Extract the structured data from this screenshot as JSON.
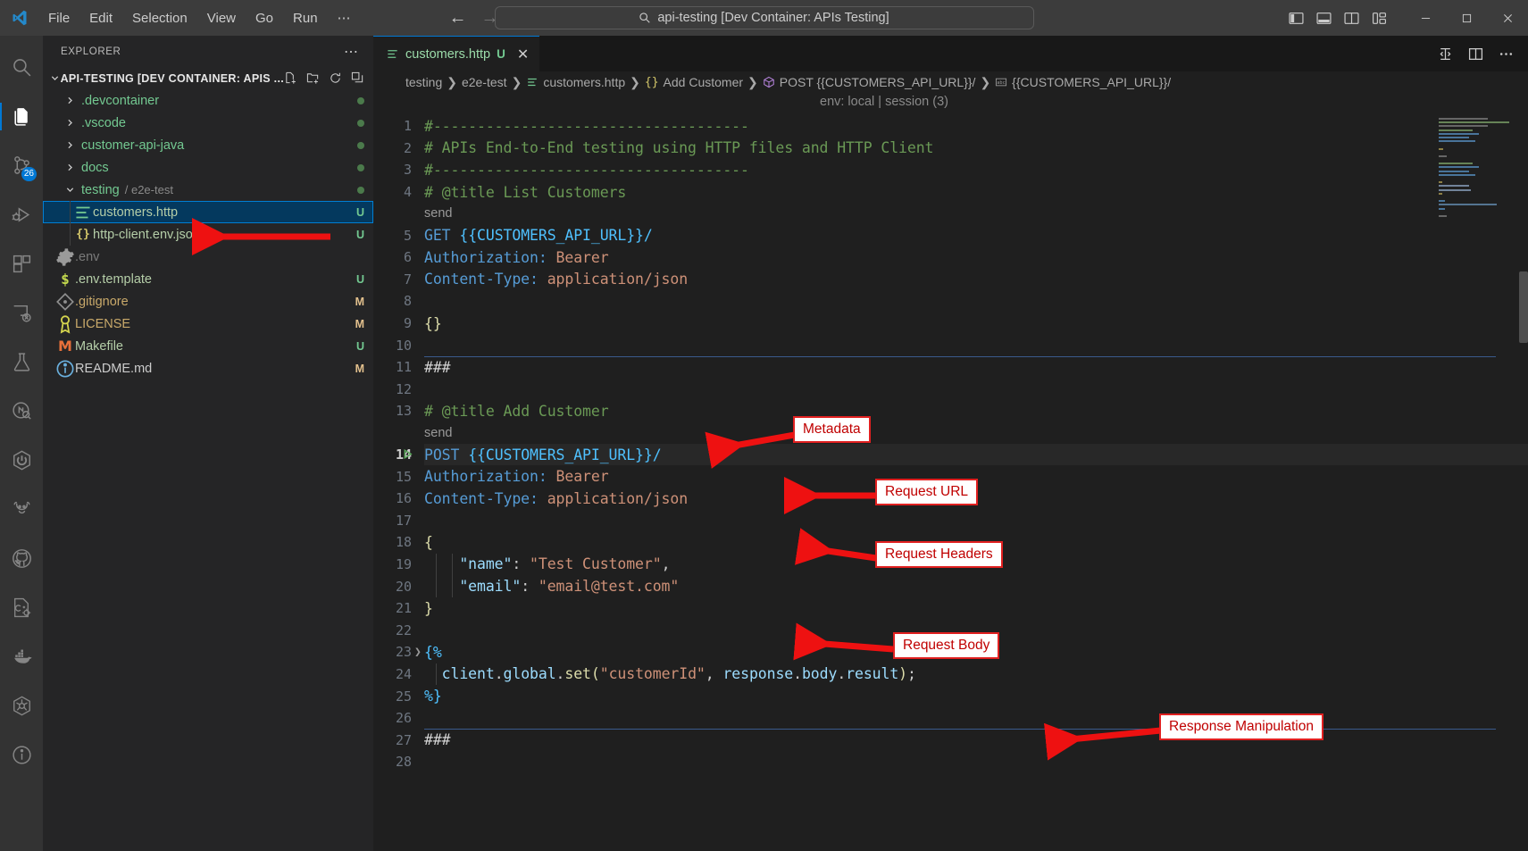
{
  "titlebar": {
    "menus": [
      "File",
      "Edit",
      "Selection",
      "View",
      "Go",
      "Run",
      "⋯"
    ],
    "quick_input": "api-testing [Dev Container: APIs Testing]",
    "search_icon": "search-icon",
    "back_icon": "arrow-left-icon",
    "forward_icon": "arrow-right-icon",
    "layout_icons": [
      "toggle-primary-sidebar-icon",
      "toggle-panel-icon",
      "toggle-secondary-sidebar-icon",
      "customize-layout-icon"
    ],
    "window_controls": [
      "minimize",
      "maximize",
      "close"
    ]
  },
  "activitybar": {
    "items": [
      {
        "name": "search-icon",
        "badge": ""
      },
      {
        "name": "explorer-icon",
        "badge": "",
        "active": true
      },
      {
        "name": "source-control-icon",
        "badge": "26"
      },
      {
        "name": "run-and-debug-icon",
        "badge": ""
      },
      {
        "name": "extensions-icon",
        "badge": ""
      },
      {
        "name": "remote-explorer-icon",
        "badge": ""
      },
      {
        "name": "testing-icon",
        "badge": ""
      },
      {
        "name": "rest-client-icon",
        "badge": ""
      },
      {
        "name": "power-icon",
        "badge": ""
      },
      {
        "name": "gradle-bull-icon",
        "badge": ""
      },
      {
        "name": "github-icon",
        "badge": ""
      },
      {
        "name": "cpp-config-icon",
        "badge": ""
      },
      {
        "name": "docker-icon",
        "badge": ""
      },
      {
        "name": "kubernetes-icon",
        "badge": ""
      },
      {
        "name": "info-icon",
        "badge": ""
      }
    ]
  },
  "sidebar": {
    "title": "EXPLORER",
    "more_icon": "ellipsis-icon",
    "root": {
      "label": "API-TESTING [DEV CONTAINER: APIS ...",
      "actions": [
        "new-file-icon",
        "new-folder-icon",
        "refresh-icon",
        "collapse-all-icon"
      ]
    },
    "items": [
      {
        "label": ".devcontainer",
        "type": "folder",
        "expanded": false,
        "badge": "",
        "dot": true
      },
      {
        "label": ".vscode",
        "type": "folder",
        "expanded": false,
        "badge": "",
        "dot": true
      },
      {
        "label": "customer-api-java",
        "type": "folder",
        "expanded": false,
        "badge": "",
        "dot": true
      },
      {
        "label": "docs",
        "type": "folder",
        "expanded": false,
        "badge": "",
        "dot": true
      },
      {
        "label": "testing",
        "sublabel": "/ e2e-test",
        "type": "folder",
        "expanded": true,
        "badge": "",
        "dot": true
      },
      {
        "label": "customers.http",
        "type": "file",
        "icon": "http-file-icon",
        "badge": "U",
        "selected": true,
        "indent": 2
      },
      {
        "label": "http-client.env.json",
        "type": "file",
        "icon": "json-file-icon",
        "badge": "U",
        "indent": 2
      },
      {
        "label": ".env",
        "type": "file",
        "icon": "gear-file-icon",
        "badge": "",
        "dim": true,
        "indent": 1
      },
      {
        "label": ".env.template",
        "type": "file",
        "icon": "dollar-file-icon",
        "badge": "U",
        "indent": 1
      },
      {
        "label": ".gitignore",
        "type": "file",
        "icon": "git-file-icon",
        "badge": "M",
        "indent": 1
      },
      {
        "label": "LICENSE",
        "type": "file",
        "icon": "license-file-icon",
        "badge": "M",
        "indent": 1
      },
      {
        "label": "Makefile",
        "type": "file",
        "icon": "makefile-icon",
        "badge": "U",
        "indent": 1
      },
      {
        "label": "README.md",
        "type": "file",
        "icon": "markdown-info-icon",
        "badge": "M",
        "indent": 1
      }
    ]
  },
  "editor": {
    "tab": {
      "label": "customers.http",
      "dirty_badge": "U",
      "icon": "http-file-icon",
      "close_icon": "close-icon"
    },
    "tab_actions": [
      "split-editor-vertical-icon",
      "split-editor-icon",
      "more-actions-icon"
    ],
    "breadcrumbs": [
      {
        "label": "testing",
        "icon": ""
      },
      {
        "label": "e2e-test",
        "icon": ""
      },
      {
        "label": "customers.http",
        "icon": "http-file-icon"
      },
      {
        "label": "Add Customer",
        "icon": "json-symbol-icon"
      },
      {
        "label": "POST {{CUSTOMERS_API_URL}}/",
        "icon": "module-symbol-icon"
      },
      {
        "label": "{{CUSTOMERS_API_URL}}/",
        "icon": "text-symbol-icon"
      }
    ],
    "env_status": "env: local | session (3)",
    "codelens_send": "send",
    "lines": [
      {
        "n": 1,
        "text": "#------------------------------------"
      },
      {
        "n": 2,
        "text": "# APIs End-to-End testing using HTTP files and HTTP Client"
      },
      {
        "n": 3,
        "text": "#------------------------------------"
      },
      {
        "n": 4,
        "text": "# @title List Customers"
      },
      {
        "n": 5,
        "text": "GET {{CUSTOMERS_API_URL}}/"
      },
      {
        "n": 6,
        "text": "Authorization: Bearer"
      },
      {
        "n": 7,
        "text": "Content-Type: application/json"
      },
      {
        "n": 8,
        "text": ""
      },
      {
        "n": 9,
        "text": "{}"
      },
      {
        "n": 10,
        "text": ""
      },
      {
        "n": 11,
        "text": "###"
      },
      {
        "n": 12,
        "text": ""
      },
      {
        "n": 13,
        "text": "# @title Add Customer"
      },
      {
        "n": 14,
        "text": "POST {{CUSTOMERS_API_URL}}/"
      },
      {
        "n": 15,
        "text": "Authorization: Bearer"
      },
      {
        "n": 16,
        "text": "Content-Type: application/json"
      },
      {
        "n": 17,
        "text": ""
      },
      {
        "n": 18,
        "text": "{"
      },
      {
        "n": 19,
        "text": "    \"name\": \"Test Customer\","
      },
      {
        "n": 20,
        "text": "    \"email\": \"email@test.com\""
      },
      {
        "n": 21,
        "text": "}"
      },
      {
        "n": 22,
        "text": ""
      },
      {
        "n": 23,
        "text": "{%"
      },
      {
        "n": 24,
        "text": "  client.global.set(\"customerId\", response.body.result);"
      },
      {
        "n": 25,
        "text": "%}"
      },
      {
        "n": 26,
        "text": ""
      },
      {
        "n": 27,
        "text": "###"
      },
      {
        "n": 28,
        "text": ""
      }
    ]
  },
  "annotations": [
    {
      "label": "Metadata"
    },
    {
      "label": "Request URL"
    },
    {
      "label": "Request Headers"
    },
    {
      "label": "Request Body"
    },
    {
      "label": "Response Manipulation"
    }
  ],
  "colors": {
    "accent": "#0078d4",
    "annotation_red": "#e02020",
    "selection_blue": "#04395e",
    "editor_bg": "#1f1f1f",
    "sidebar_bg": "#252526"
  }
}
